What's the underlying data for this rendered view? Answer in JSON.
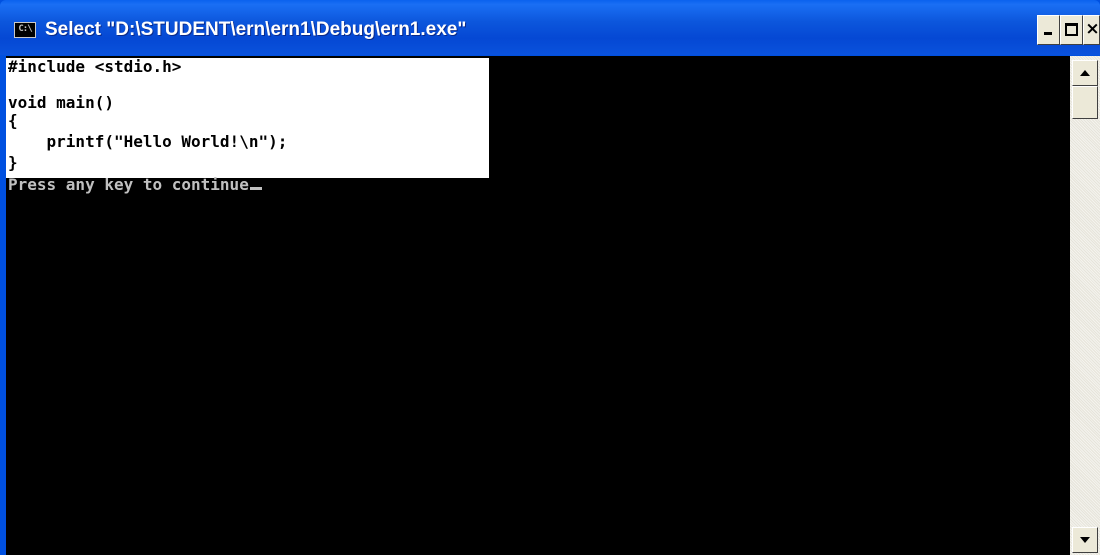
{
  "window": {
    "title": "Select \"D:\\STUDENT\\ern\\ern1\\Debug\\ern1.exe\"",
    "icon_name": "console-app-icon",
    "icon_label": "C:\\",
    "titlebar_color": "#0a52dc",
    "buttons": {
      "minimize_icon": "minimize-icon",
      "maximize_icon": "maximize-icon",
      "close_icon": "close-icon",
      "close_glyph": "×"
    }
  },
  "console": {
    "background_color": "#000000",
    "text_color": "#c0c0c0",
    "selection_color": "#ffffff",
    "selected_lines": [
      "#include <stdio.h>",
      "",
      "void main()",
      "{",
      "    printf(\"Hello World!\\n\");",
      "}"
    ],
    "output_line": "Press any key to continue"
  },
  "scrollbar": {
    "up_icon": "scroll-up-arrow-icon",
    "down_icon": "scroll-down-arrow-icon",
    "position": 0
  }
}
